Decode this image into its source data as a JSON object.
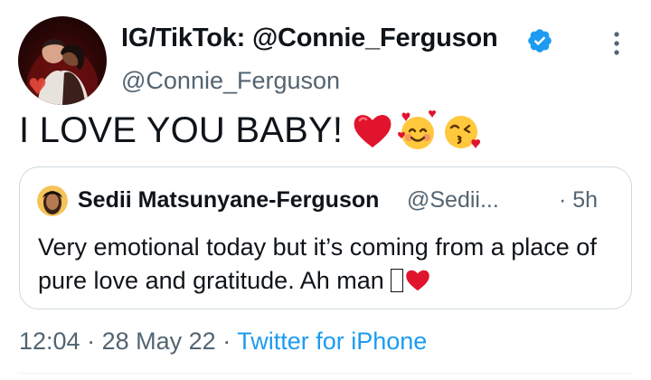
{
  "author": {
    "display_name": "IG/TikTok: @Connie_Ferguson",
    "handle": "@Connie_Ferguson",
    "verified": true
  },
  "tweet": {
    "text": "I LOVE YOU BABY!",
    "emojis": [
      "red-heart",
      "smiling-face-with-hearts",
      "face-blowing-a-kiss"
    ]
  },
  "quoted_tweet": {
    "display_name": "Sedii Matsunyane-Ferguson",
    "handle": "@Sedii...",
    "separator": "·",
    "time": "5h",
    "text": "Very emotional today but it’s coming from a place of pure love and gratitude. Ah man",
    "trailing_emoji": "red-heart"
  },
  "meta": {
    "time": "12:04",
    "sep1": "·",
    "date": "28 May 22",
    "sep2": "·",
    "source": "Twitter for iPhone"
  },
  "colors": {
    "text": "#0f1419",
    "secondary": "#536471",
    "accent": "#1d9bf0",
    "border": "#cfd9de",
    "heart": "#e0142c"
  },
  "icons": {
    "verified": "verified-badge-icon",
    "more": "more-options-icon"
  }
}
